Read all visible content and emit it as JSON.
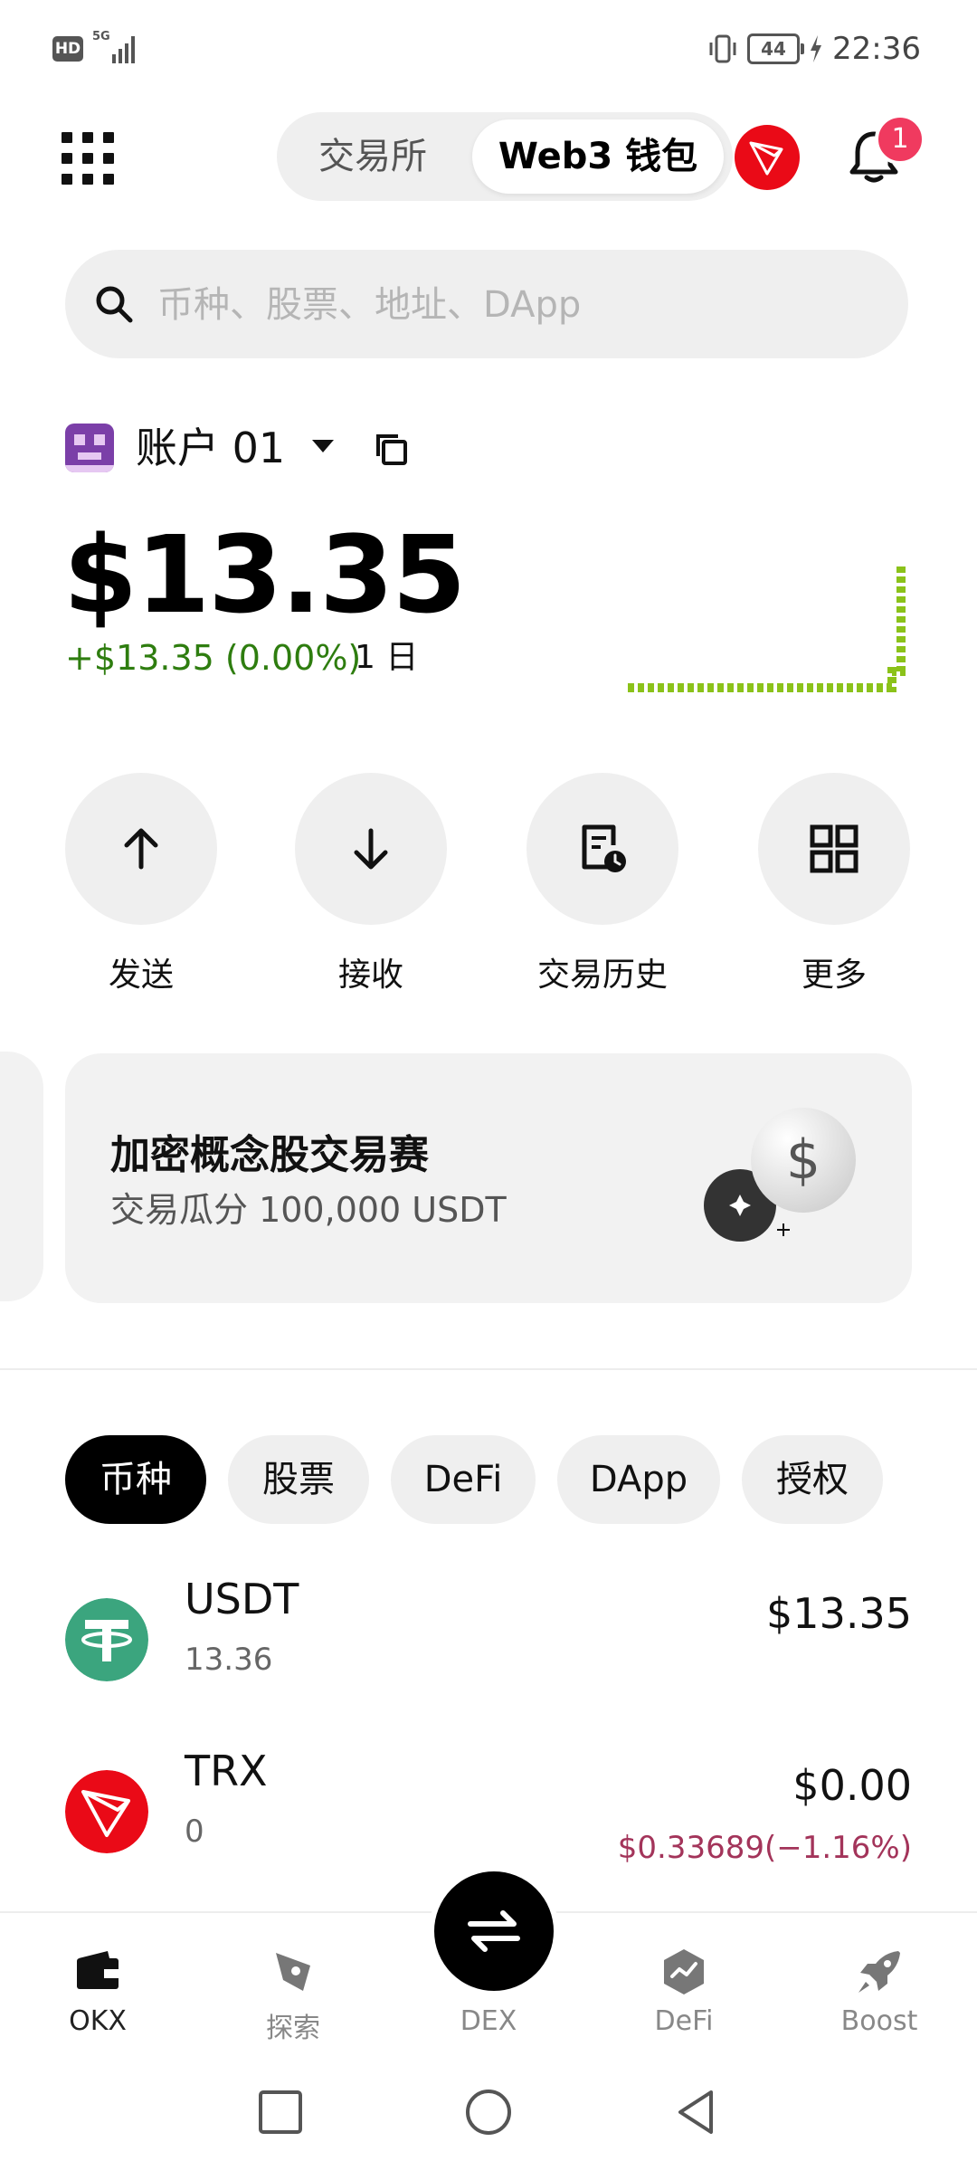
{
  "status_bar": {
    "hd": "HD",
    "network": "5G",
    "battery": "44",
    "time": "22:36"
  },
  "header": {
    "mode_exchange": "交易所",
    "mode_web3": "Web3 钱包",
    "notification_count": "1"
  },
  "search": {
    "placeholder": "币种、股票、地址、DApp"
  },
  "account": {
    "name": "账户 01",
    "balance": "$13.35",
    "change": "+$13.35 (0.00%)",
    "period": "1 日"
  },
  "actions": [
    {
      "label": "发送",
      "icon": "arrow-up-icon"
    },
    {
      "label": "接收",
      "icon": "arrow-down-icon"
    },
    {
      "label": "交易历史",
      "icon": "history-icon"
    },
    {
      "label": "更多",
      "icon": "grid-icon"
    }
  ],
  "promo": {
    "title": "加密概念股交易赛",
    "subtitle": "交易瓜分 100,000 USDT"
  },
  "asset_tabs": [
    {
      "label": "币种",
      "active": true
    },
    {
      "label": "股票",
      "active": false
    },
    {
      "label": "DeFi",
      "active": false
    },
    {
      "label": "DApp",
      "active": false
    },
    {
      "label": "授权",
      "active": false
    }
  ],
  "tokens": [
    {
      "symbol": "USDT",
      "amount": "13.36",
      "value": "$13.35",
      "price": ""
    },
    {
      "symbol": "TRX",
      "amount": "0",
      "value": "$0.00",
      "price": "$0.33689(−1.16%)"
    }
  ],
  "bottom_nav": [
    {
      "label": "OKX",
      "icon": "wallet-icon",
      "active": true
    },
    {
      "label": "探索",
      "icon": "compass-icon",
      "active": false
    },
    {
      "label": "DEX",
      "icon": "swap-icon",
      "active": false
    },
    {
      "label": "DeFi",
      "icon": "defi-icon",
      "active": false
    },
    {
      "label": "Boost",
      "icon": "rocket-icon",
      "active": false
    }
  ],
  "colors": {
    "accent_green": "#2e7d0f",
    "sparkline": "#8bc21a",
    "negative": "#a3345a",
    "tron_red": "#ea0a17",
    "tether_green": "#3ba57e",
    "badge_red": "#f03a5f"
  }
}
